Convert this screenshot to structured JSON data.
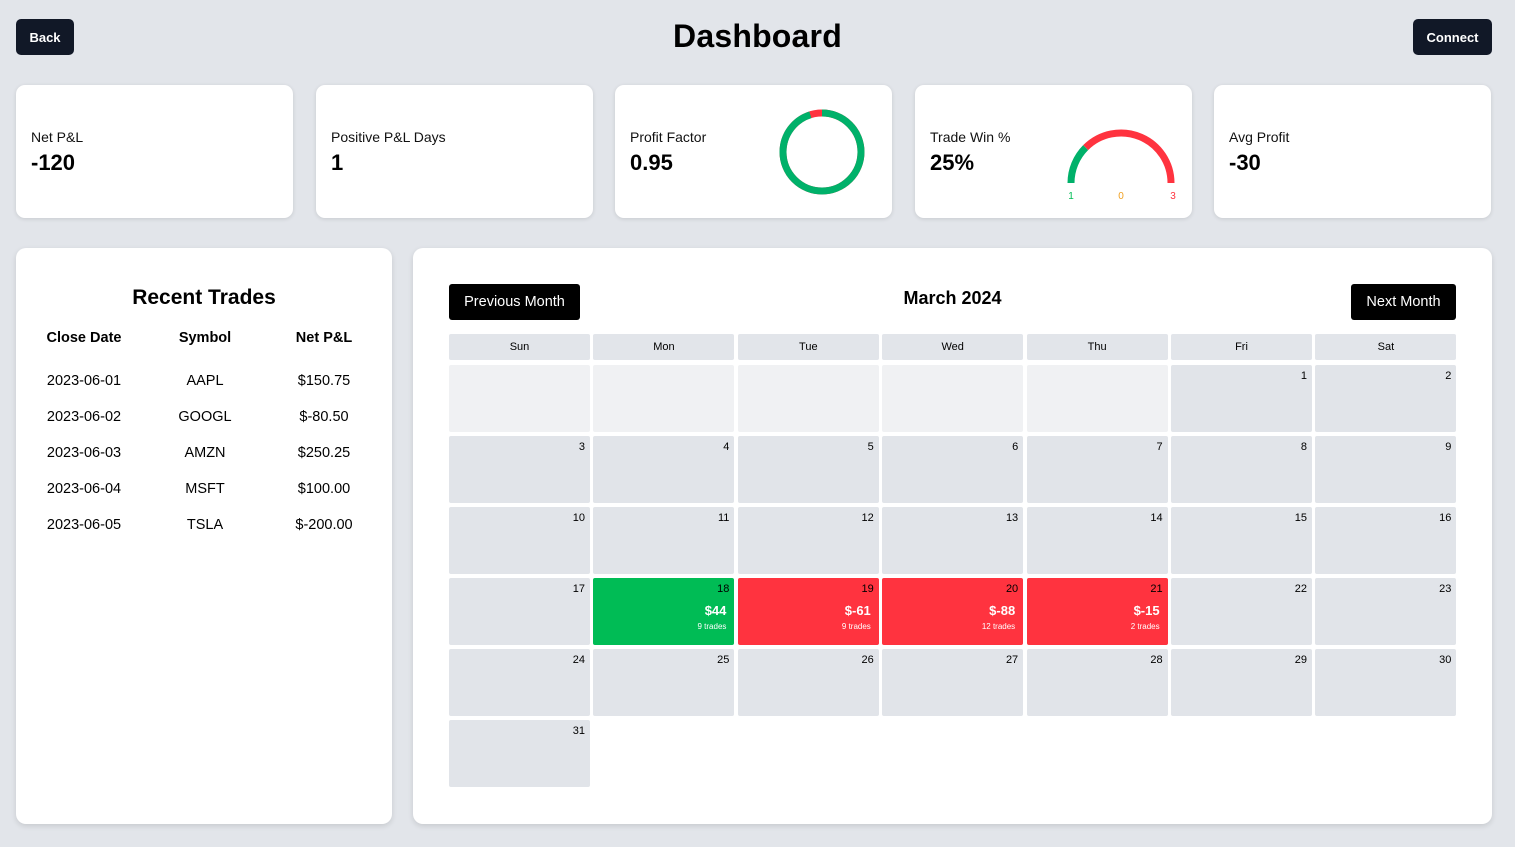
{
  "header": {
    "back_label": "Back",
    "title": "Dashboard",
    "connect_label": "Connect"
  },
  "stats": {
    "net_pnl": {
      "label": "Net P&L",
      "value": "-120"
    },
    "positive_days": {
      "label": "Positive P&L Days",
      "value": "1"
    },
    "profit_factor": {
      "label": "Profit Factor",
      "value": "0.95",
      "ring_fraction": 0.95
    },
    "win_pct": {
      "label": "Trade Win %",
      "value": "25%",
      "wins": "1",
      "breakeven": "0",
      "losses": "3"
    },
    "avg_profit": {
      "label": "Avg Profit",
      "value": "-30"
    }
  },
  "colors": {
    "green": "#00bc55",
    "red": "#ff333f",
    "orange": "#f0a020",
    "ring_green": "#00b16a"
  },
  "recent_trades": {
    "title": "Recent Trades",
    "headers": [
      "Close Date",
      "Symbol",
      "Net P&L"
    ],
    "rows": [
      [
        "2023-06-01",
        "AAPL",
        "$150.75"
      ],
      [
        "2023-06-02",
        "GOOGL",
        "$-80.50"
      ],
      [
        "2023-06-03",
        "AMZN",
        "$250.25"
      ],
      [
        "2023-06-04",
        "MSFT",
        "$100.00"
      ],
      [
        "2023-06-05",
        "TSLA",
        "$-200.00"
      ]
    ]
  },
  "calendar": {
    "prev_label": "Previous Month",
    "next_label": "Next Month",
    "month_title": "March 2024",
    "weekdays": [
      "Sun",
      "Mon",
      "Tue",
      "Wed",
      "Thu",
      "Fri",
      "Sat"
    ],
    "leading_blank_days": 5,
    "days_in_month": 31,
    "trade_days": {
      "18": {
        "amount": "$44",
        "trades": "9 trades",
        "status": "green"
      },
      "19": {
        "amount": "$-61",
        "trades": "9 trades",
        "status": "red"
      },
      "20": {
        "amount": "$-88",
        "trades": "12 trades",
        "status": "red"
      },
      "21": {
        "amount": "$-15",
        "trades": "2 trades",
        "status": "red"
      }
    }
  }
}
